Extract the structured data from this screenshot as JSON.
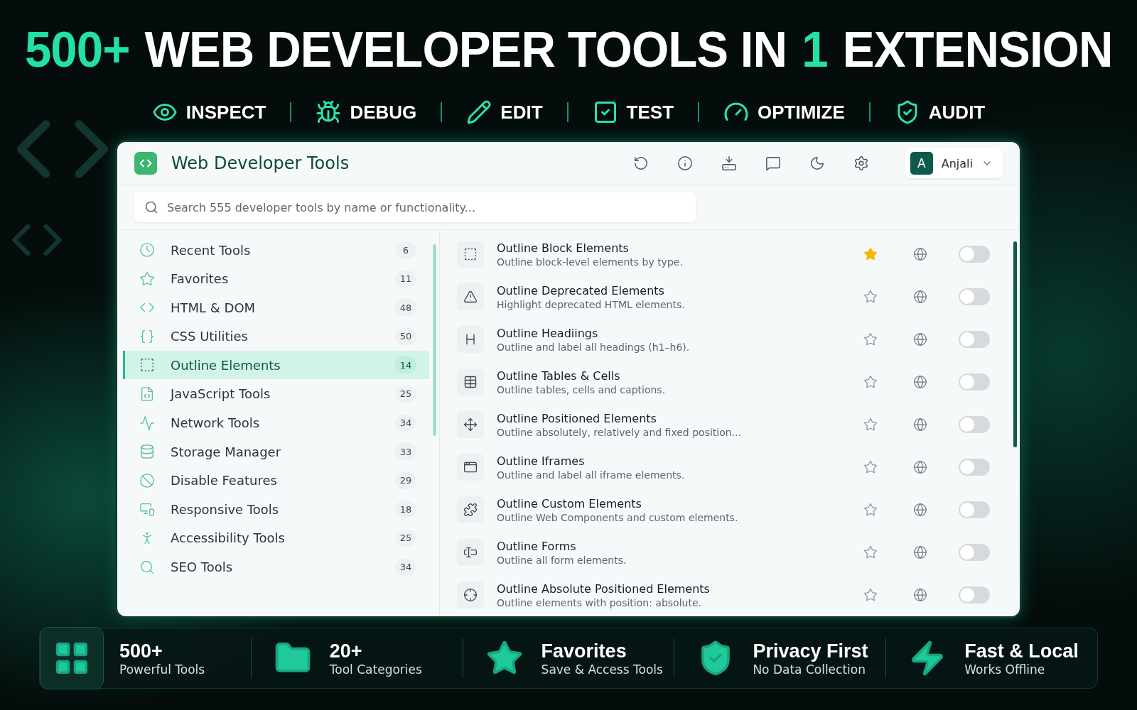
{
  "headline": [
    {
      "text": "500+",
      "accent": true
    },
    {
      "text": "WEB DEVELOPER TOOLS IN",
      "accent": false
    },
    {
      "text": "1",
      "accent": true
    },
    {
      "text": "EXTENSION",
      "accent": false
    }
  ],
  "features": [
    {
      "label": "INSPECT"
    },
    {
      "label": "DEBUG"
    },
    {
      "label": "EDIT"
    },
    {
      "label": "TEST"
    },
    {
      "label": "OPTIMIZE"
    },
    {
      "label": "AUDIT"
    }
  ],
  "app": {
    "title": "Web Developer Tools",
    "user": {
      "initial": "A",
      "name": "Anjali"
    },
    "search": {
      "placeholder": "Search 555 developer tools by name or functionality..."
    }
  },
  "sidebar": {
    "items": [
      {
        "label": "Recent Tools",
        "count": "6",
        "selected": false
      },
      {
        "label": "Favorites",
        "count": "11",
        "selected": false
      },
      {
        "label": "HTML & DOM",
        "count": "48",
        "selected": false
      },
      {
        "label": "CSS Utilities",
        "count": "50",
        "selected": false
      },
      {
        "label": "Outline Elements",
        "count": "14",
        "selected": true
      },
      {
        "label": "JavaScript Tools",
        "count": "25",
        "selected": false
      },
      {
        "label": "Network Tools",
        "count": "34",
        "selected": false
      },
      {
        "label": "Storage Manager",
        "count": "33",
        "selected": false
      },
      {
        "label": "Disable Features",
        "count": "29",
        "selected": false
      },
      {
        "label": "Responsive Tools",
        "count": "18",
        "selected": false
      },
      {
        "label": "Accessibility Tools",
        "count": "25",
        "selected": false
      },
      {
        "label": "SEO Tools",
        "count": "34",
        "selected": false
      }
    ]
  },
  "tools": [
    {
      "name": "Outline Block Elements",
      "description": "Outline block-level elements by type.",
      "favorite": true,
      "on": false
    },
    {
      "name": "Outline Deprecated Elements",
      "description": "Highlight deprecated HTML elements.",
      "favorite": false,
      "on": false
    },
    {
      "name": "Outline Headiings",
      "description": "Outline and label all headings (h1–h6).",
      "favorite": false,
      "on": false
    },
    {
      "name": "Outline Tables & Cells",
      "description": "Outline tables, cells and captions.",
      "favorite": false,
      "on": false
    },
    {
      "name": "Outline Positioned Elements",
      "description": "Outline absolutely, relatively and fixed position...",
      "favorite": false,
      "on": false
    },
    {
      "name": "Outline Iframes",
      "description": "Outline and label all iframe elements.",
      "favorite": false,
      "on": false
    },
    {
      "name": "Outline Custom Elements",
      "description": "Outline Web Components and custom elements.",
      "favorite": false,
      "on": false
    },
    {
      "name": "Outline Forms",
      "description": "Outline all form elements.",
      "favorite": false,
      "on": false
    },
    {
      "name": "Outline Absolute Positioned Elements",
      "description": "Outline elements with position: absolute.",
      "favorite": false,
      "on": false
    }
  ],
  "highlights": [
    {
      "title": "500+",
      "subtitle": "Powerful Tools"
    },
    {
      "title": "20+",
      "subtitle": "Tool Categories"
    },
    {
      "title": "Favorites",
      "subtitle": "Save & Access Tools"
    },
    {
      "title": "Privacy First",
      "subtitle": "No Data Collection"
    },
    {
      "title": "Fast & Local",
      "subtitle": "Works Offline"
    }
  ]
}
